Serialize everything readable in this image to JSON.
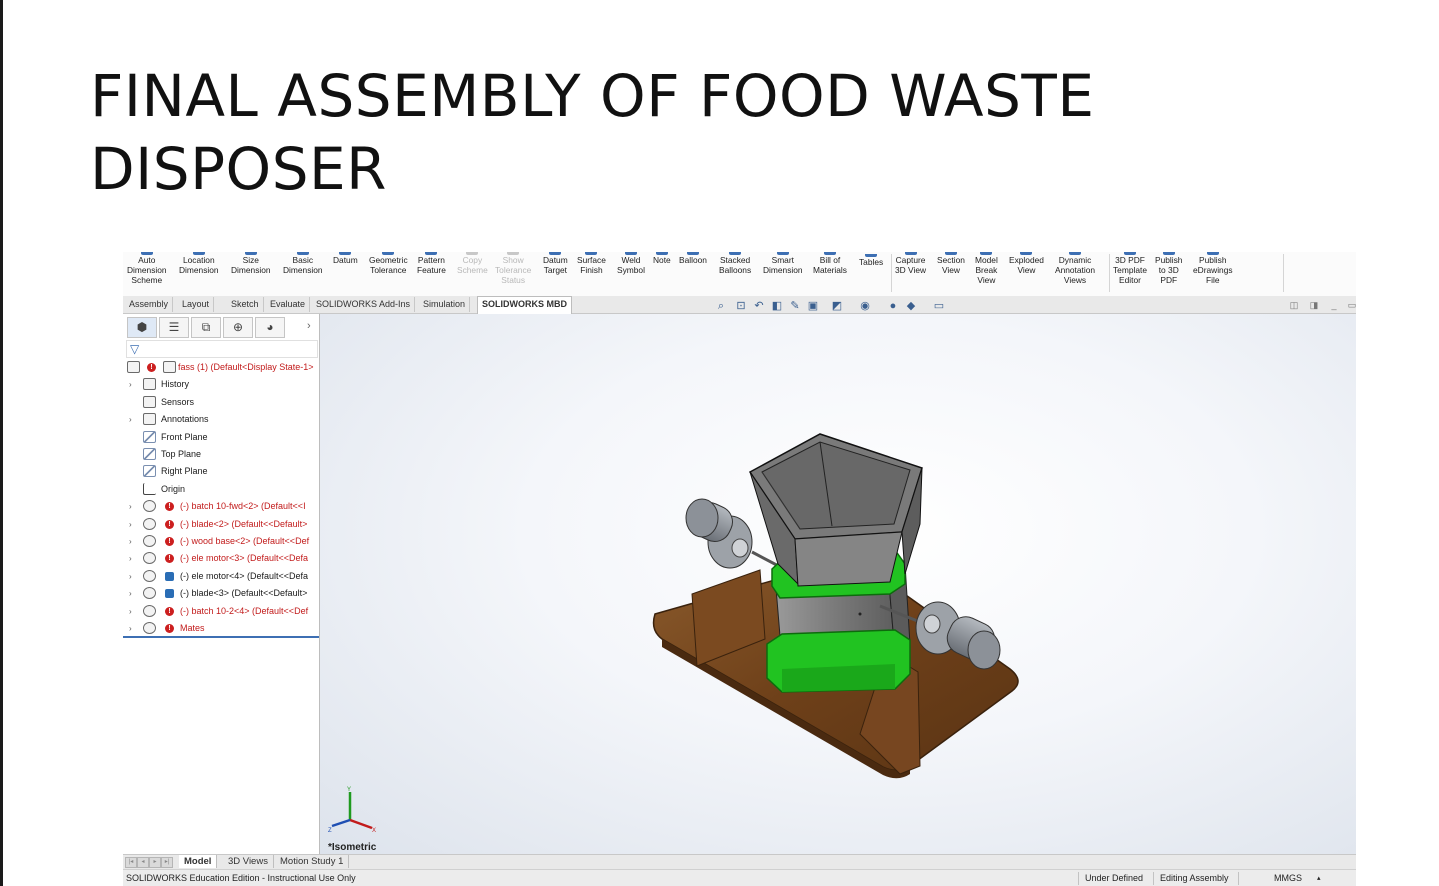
{
  "slide": {
    "title_line1": "FINAL ASSEMBLY OF FOOD WASTE",
    "title_line2": "DISPOSER"
  },
  "ribbon": {
    "groups": [
      {
        "label": "Auto\nDimension\nScheme",
        "icon": "auto-dimension-icon",
        "enabled": true
      },
      {
        "label": "Location\nDimension",
        "icon": "location-dimension-icon",
        "enabled": true
      },
      {
        "label": "Size\nDimension",
        "icon": "size-dimension-icon",
        "enabled": true
      },
      {
        "label": "Basic\nDimension",
        "icon": "basic-dimension-icon",
        "enabled": true
      },
      {
        "label": "Datum",
        "icon": "datum-icon",
        "enabled": true
      },
      {
        "label": "Geometric\nTolerance",
        "icon": "geometric-tolerance-icon",
        "enabled": true
      },
      {
        "label": "Pattern\nFeature",
        "icon": "pattern-feature-icon",
        "enabled": true
      },
      {
        "label": "Copy\nScheme",
        "icon": "copy-scheme-icon",
        "enabled": false
      },
      {
        "label": "Show\nTolerance\nStatus",
        "icon": "tolerance-status-icon",
        "enabled": false
      },
      {
        "label": "Datum\nTarget",
        "icon": "datum-target-icon",
        "enabled": true
      },
      {
        "label": "Surface\nFinish",
        "icon": "surface-finish-icon",
        "enabled": true
      },
      {
        "label": "Weld\nSymbol",
        "icon": "weld-symbol-icon",
        "enabled": true
      },
      {
        "label": "Note",
        "icon": "note-icon",
        "enabled": true
      },
      {
        "label": "Balloon",
        "icon": "balloon-icon",
        "enabled": true
      },
      {
        "label": "Stacked\nBalloons",
        "icon": "stacked-balloons-icon",
        "enabled": true
      },
      {
        "label": "Smart\nDimension",
        "icon": "smart-dimension-icon",
        "enabled": true
      },
      {
        "label": "Bill of\nMaterials",
        "icon": "bill-of-materials-icon",
        "enabled": true
      },
      {
        "label": "Tables",
        "icon": "tables-icon",
        "enabled": true
      },
      {
        "label": "Capture\n3D View",
        "icon": "capture-3d-view-icon",
        "enabled": true
      },
      {
        "label": "Section\nView",
        "icon": "section-view-icon",
        "enabled": true
      },
      {
        "label": "Model\nBreak\nView",
        "icon": "model-break-view-icon",
        "enabled": true
      },
      {
        "label": "Exploded\nView",
        "icon": "exploded-view-icon",
        "enabled": true
      },
      {
        "label": "Dynamic\nAnnotation\nViews",
        "icon": "dynamic-annotation-icon",
        "enabled": true
      },
      {
        "label": "3D PDF\nTemplate\nEditor",
        "icon": "pdf-template-icon",
        "enabled": true
      },
      {
        "label": "Publish\nto 3D\nPDF",
        "icon": "publish-3d-pdf-icon",
        "enabled": true
      },
      {
        "label": "Publish\neDrawings\nFile",
        "icon": "publish-edrawings-icon",
        "enabled": true
      }
    ]
  },
  "command_tabs": [
    "Assembly",
    "Layout",
    "Sketch",
    "Evaluate",
    "SOLIDWORKS Add-Ins",
    "Simulation",
    "SOLIDWORKS MBD"
  ],
  "active_command_tab": "SOLIDWORKS MBD",
  "panel": {
    "tree": [
      {
        "label": "fass (1)  (Default<Display State-1>",
        "kind": "root",
        "color": "red",
        "expandable": false
      },
      {
        "label": "History",
        "kind": "folder",
        "color": "black",
        "expandable": true
      },
      {
        "label": "Sensors",
        "kind": "folder",
        "color": "black",
        "expandable": false
      },
      {
        "label": "Annotations",
        "kind": "folder",
        "color": "black",
        "expandable": true
      },
      {
        "label": "Front Plane",
        "kind": "plane",
        "color": "black",
        "expandable": false
      },
      {
        "label": "Top Plane",
        "kind": "plane",
        "color": "black",
        "expandable": false
      },
      {
        "label": "Right Plane",
        "kind": "plane",
        "color": "black",
        "expandable": false
      },
      {
        "label": "Origin",
        "kind": "origin",
        "color": "black",
        "expandable": false
      },
      {
        "label": "(-) batch 10-fwd<2> (Default<<I",
        "kind": "part-error",
        "color": "red",
        "expandable": true
      },
      {
        "label": "(-) blade<2> (Default<<Default>",
        "kind": "part-error",
        "color": "red",
        "expandable": true
      },
      {
        "label": "(-) wood base<2> (Default<<Def",
        "kind": "part-error",
        "color": "red",
        "expandable": true
      },
      {
        "label": "(-) ele motor<3> (Default<<Defa",
        "kind": "part-error",
        "color": "red",
        "expandable": true
      },
      {
        "label": "(-) ele motor<4> (Default<<Defa",
        "kind": "part-ok",
        "color": "black",
        "expandable": true
      },
      {
        "label": "(-) blade<3> (Default<<Default>",
        "kind": "part-ok",
        "color": "black",
        "expandable": true
      },
      {
        "label": "(-) batch 10-2<4> (Default<<Def",
        "kind": "part-error",
        "color": "red",
        "expandable": true
      },
      {
        "label": "Mates",
        "kind": "mates",
        "color": "red",
        "expandable": true
      }
    ]
  },
  "viewport": {
    "view_label": "*Isometric",
    "colors": {
      "wood": "#7a4a22",
      "hopper": "#6f6f6f",
      "collar": "#21c321",
      "motor": "#8a8f96"
    }
  },
  "bottom_tabs": [
    "Model",
    "3D Views",
    "Motion Study 1"
  ],
  "active_bottom_tab": "Model",
  "status": {
    "product": "SOLIDWORKS Education Edition - Instructional Use Only",
    "state": "Under Defined",
    "mode": "Editing Assembly",
    "units": "MMGS"
  }
}
